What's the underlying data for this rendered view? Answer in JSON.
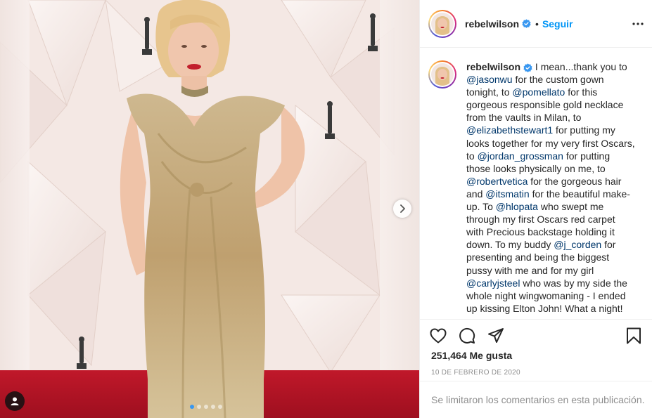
{
  "post": {
    "username": "rebelwilson",
    "follow_label": "Seguir",
    "separator": "•",
    "caption": {
      "username": "rebelwilson",
      "segments": [
        {
          "type": "text",
          "value": " I mean...thank you to "
        },
        {
          "type": "mention",
          "value": "@jasonwu"
        },
        {
          "type": "text",
          "value": " for the custom gown tonight, to "
        },
        {
          "type": "mention",
          "value": "@pomellato"
        },
        {
          "type": "text",
          "value": " for this gorgeous responsible gold necklace from the vaults in Milan, to "
        },
        {
          "type": "mention",
          "value": "@elizabethstewart1"
        },
        {
          "type": "text",
          "value": " for putting my looks together for my very first Oscars, to "
        },
        {
          "type": "mention",
          "value": "@jordan_grossman"
        },
        {
          "type": "text",
          "value": " for putting those looks physically on me, to "
        },
        {
          "type": "mention",
          "value": "@robertvetica"
        },
        {
          "type": "text",
          "value": " for the gorgeous hair and "
        },
        {
          "type": "mention",
          "value": "@itsmatin"
        },
        {
          "type": "text",
          "value": " for the beautiful make-up. To "
        },
        {
          "type": "mention",
          "value": "@hlopata"
        },
        {
          "type": "text",
          "value": " who swept me through my first Oscars red carpet with Precious backstage holding it down. To my buddy "
        },
        {
          "type": "mention",
          "value": "@j_corden"
        },
        {
          "type": "text",
          "value": " for presenting and being the biggest pussy with me and for my girl "
        },
        {
          "type": "mention",
          "value": "@carlyjsteel"
        },
        {
          "type": "text",
          "value": " who was by my side the whole night wingwomaning - I ended up kissing Elton John! What a night!"
        }
      ]
    },
    "likes_text": "251,464 Me gusta",
    "date_text": "10 DE FEBRERO DE 2020",
    "comments_disabled_text": "Se limitaron los comentarios en esta publicación.",
    "carousel": {
      "total": 5,
      "active": 0
    },
    "icons": {
      "verified": "verified-badge-icon",
      "more": "more-options-icon",
      "like": "heart-icon",
      "comment": "comment-icon",
      "share": "share-icon",
      "save": "bookmark-icon",
      "next": "chevron-right-icon",
      "tag": "user-tag-icon"
    },
    "colors": {
      "link": "#00376b",
      "follow": "#0095f6",
      "verified": "#3897f0",
      "muted": "#8e8e8e",
      "carpet": "#b3142a",
      "gown": "#c9ad7e"
    }
  }
}
